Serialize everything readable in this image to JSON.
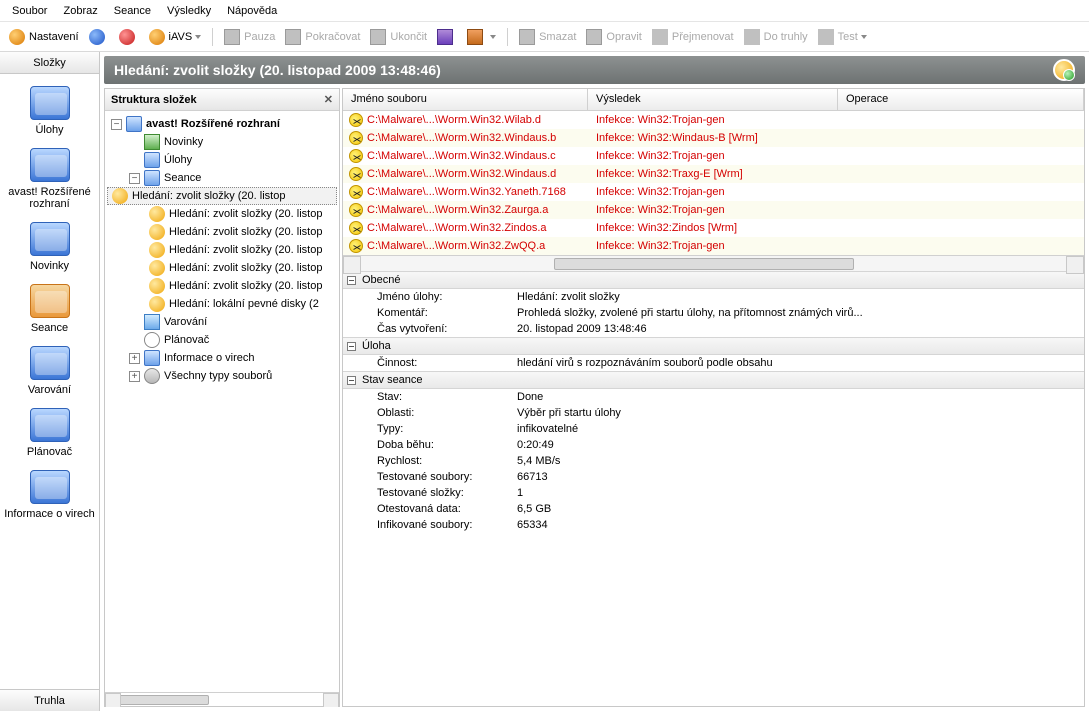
{
  "menus": [
    "Soubor",
    "Zobraz",
    "Seance",
    "Výsledky",
    "Nápověda"
  ],
  "toolbar": {
    "settings": "Nastavení",
    "iavs": "iAVS",
    "pause": "Pauza",
    "continue": "Pokračovat",
    "end": "Ukončit",
    "delete": "Smazat",
    "repair": "Opravit",
    "rename": "Přejmenovat",
    "chest": "Do truhly",
    "test": "Test"
  },
  "side": {
    "header": "Složky",
    "footer": "Truhla",
    "items": [
      {
        "label": "Úlohy"
      },
      {
        "label": "avast! Rozšířené rozhraní"
      },
      {
        "label": "Novinky"
      },
      {
        "label": "Seance"
      },
      {
        "label": "Varování"
      },
      {
        "label": "Plánovač"
      },
      {
        "label": "Informace o virech"
      }
    ]
  },
  "title": "Hledání: zvolit složky (20. listopad 2009 13:48:46)",
  "tree": {
    "header": "Struktura složek",
    "root": "avast! Rozšířené rozhraní",
    "n_novinky": "Novinky",
    "n_ulohy": "Úlohy",
    "n_seance": "Seance",
    "scan1": "Hledání: zvolit složky (20. listop",
    "scan2": "Hledání: zvolit složky (20. listop",
    "scan3": "Hledání: zvolit složky (20. listop",
    "scan4": "Hledání: zvolit složky (20. listop",
    "scan5": "Hledání: zvolit složky (20. listop",
    "scan6": "Hledání: zvolit složky (20. listop",
    "scan7": "Hledání: lokální pevné disky (2",
    "n_varovani": "Varování",
    "n_planovac": "Plánovač",
    "n_info": "Informace o virech",
    "n_types": "Všechny typy souborů"
  },
  "columns": {
    "c1": "Jméno souboru",
    "c2": "Výsledek",
    "c3": "Operace"
  },
  "rows": [
    {
      "file": "C:\\Malware\\...\\Worm.Win32.Wilab.d",
      "res": "Infekce: Win32:Trojan-gen"
    },
    {
      "file": "C:\\Malware\\...\\Worm.Win32.Windaus.b",
      "res": "Infekce: Win32:Windaus-B [Wrm]"
    },
    {
      "file": "C:\\Malware\\...\\Worm.Win32.Windaus.c",
      "res": "Infekce: Win32:Trojan-gen"
    },
    {
      "file": "C:\\Malware\\...\\Worm.Win32.Windaus.d",
      "res": "Infekce: Win32:Traxg-E [Wrm]"
    },
    {
      "file": "C:\\Malware\\...\\Worm.Win32.Yaneth.7168",
      "res": "Infekce: Win32:Trojan-gen"
    },
    {
      "file": "C:\\Malware\\...\\Worm.Win32.Zaurga.a",
      "res": "Infekce: Win32:Trojan-gen"
    },
    {
      "file": "C:\\Malware\\...\\Worm.Win32.Zindos.a",
      "res": "Infekce: Win32:Zindos [Wrm]"
    },
    {
      "file": "C:\\Malware\\...\\Worm.Win32.ZwQQ.a",
      "res": "Infekce: Win32:Trojan-gen"
    }
  ],
  "sections": {
    "general": "Obecné",
    "task": "Úloha",
    "session": "Stav seance"
  },
  "general": {
    "k_name": "Jméno úlohy:",
    "v_name": "Hledání: zvolit složky",
    "k_comment": "Komentář:",
    "v_comment": "Prohledá složky, zvolené při startu úlohy, na přítomnost známých virů...",
    "k_created": "Čas vytvoření:",
    "v_created": "20. listopad 2009 13:48:46"
  },
  "task": {
    "k_action": "Činnost:",
    "v_action": "hledání virů s rozpoznáváním souborů podle obsahu"
  },
  "session": {
    "k_state": "Stav:",
    "v_state": "Done",
    "k_areas": "Oblasti:",
    "v_areas": "Výběr při startu úlohy",
    "k_types": "Typy:",
    "v_types": "infikovatelné",
    "k_runtime": "Doba běhu:",
    "v_runtime": "0:20:49",
    "k_speed": "Rychlost:",
    "v_speed": "5,4 MB/s",
    "k_tfiles": "Testované soubory:",
    "v_tfiles": "66713",
    "k_tfolders": "Testované složky:",
    "v_tfolders": "1",
    "k_tdata": "Otestovaná data:",
    "v_tdata": "6,5 GB",
    "k_infected": "Infikované soubory:",
    "v_infected": "65334"
  }
}
